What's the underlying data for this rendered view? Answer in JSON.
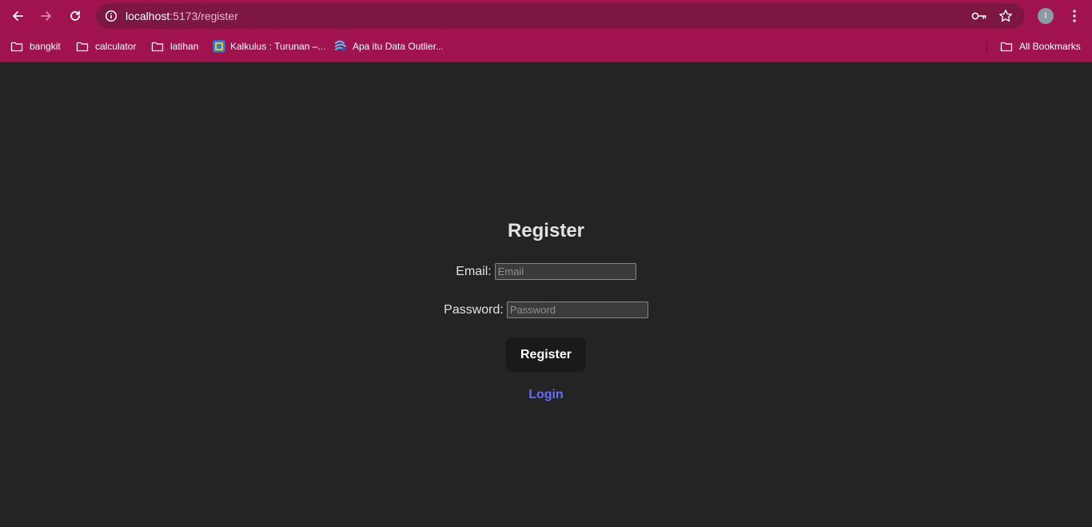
{
  "browser": {
    "url_host": "localhost",
    "url_path": ":5173/register",
    "profile_initial": "I",
    "bookmarks": [
      {
        "label": "bangkit",
        "icon": "folder-icon"
      },
      {
        "label": "calculator",
        "icon": "folder-icon"
      },
      {
        "label": "latihan",
        "icon": "folder-icon"
      },
      {
        "label": "Kalkulus : Turunan –...",
        "icon": "site-favicon"
      },
      {
        "label": "Apa itu Data Outlier...",
        "icon": "site-favicon"
      }
    ],
    "all_bookmarks_label": "All Bookmarks",
    "colors": {
      "toolbar": "#a1134f",
      "omnibox": "#7d1742"
    }
  },
  "page": {
    "title": "Register",
    "email": {
      "label": "Email:",
      "placeholder": "Email",
      "value": ""
    },
    "password": {
      "label": "Password:",
      "placeholder": "Password",
      "value": ""
    },
    "submit_label": "Register",
    "login_link_label": "Login",
    "colors": {
      "background": "#242424",
      "button": "#1a1a1a",
      "link": "#646cff"
    }
  }
}
